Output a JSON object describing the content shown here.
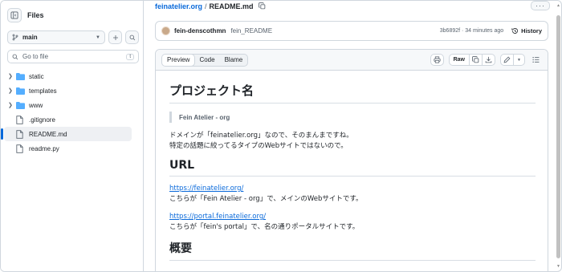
{
  "sidebar": {
    "title": "Files",
    "branch": "main",
    "goto_placeholder": "Go to file",
    "goto_shortcut": "t",
    "items": [
      {
        "label": "static",
        "type": "folder"
      },
      {
        "label": "templates",
        "type": "folder"
      },
      {
        "label": "www",
        "type": "folder"
      },
      {
        "label": ".gitignore",
        "type": "file"
      },
      {
        "label": "README.md",
        "type": "file",
        "selected": true
      },
      {
        "label": "readme.py",
        "type": "file"
      }
    ]
  },
  "header": {
    "repo": "feinatelier.org",
    "separator": "/",
    "file": "README.md",
    "more": "···"
  },
  "commit": {
    "author": "fein-denscothmn",
    "message": "fein_README",
    "sha_time": "3b6892f · 34 minutes ago",
    "history_label": "History"
  },
  "viewer": {
    "tabs": [
      "Preview",
      "Code",
      "Blame"
    ],
    "active_tab": "Preview",
    "raw_label": "Raw"
  },
  "readme": {
    "h1": "プロジェクト名",
    "quote": "Fein Atelier - org",
    "intro_line1": "ドメインが「feinatelier.org」なので、そのまんまですね。",
    "intro_line2": "特定の話題に絞ってるタイプのWebサイトではないので。",
    "h2_url": "URL",
    "link1": "https://feinatelier.org/",
    "link1_desc": "こちらが「Fein Atelier - org」で、メインのWebサイトです。",
    "link2": "https://portal.feinatelier.org/",
    "link2_desc": "こちらが「fein's portal」で、名の通りポータルサイトです。",
    "h2_overview": "概要"
  },
  "colors": {
    "accent": "#0969da",
    "border": "#d0d7de",
    "folder": "#54aeff",
    "muted": "#59636e"
  },
  "icons": {
    "sidebar_toggle": "sidebar-collapse-icon",
    "branch": "git-branch-icon",
    "add": "plus-icon",
    "search": "search-icon",
    "folder": "folder-icon",
    "file": "file-icon",
    "copy": "copy-icon",
    "history": "history-icon",
    "print": "printer-icon",
    "download": "download-icon",
    "edit": "pencil-icon",
    "list": "list-unordered-icon"
  }
}
